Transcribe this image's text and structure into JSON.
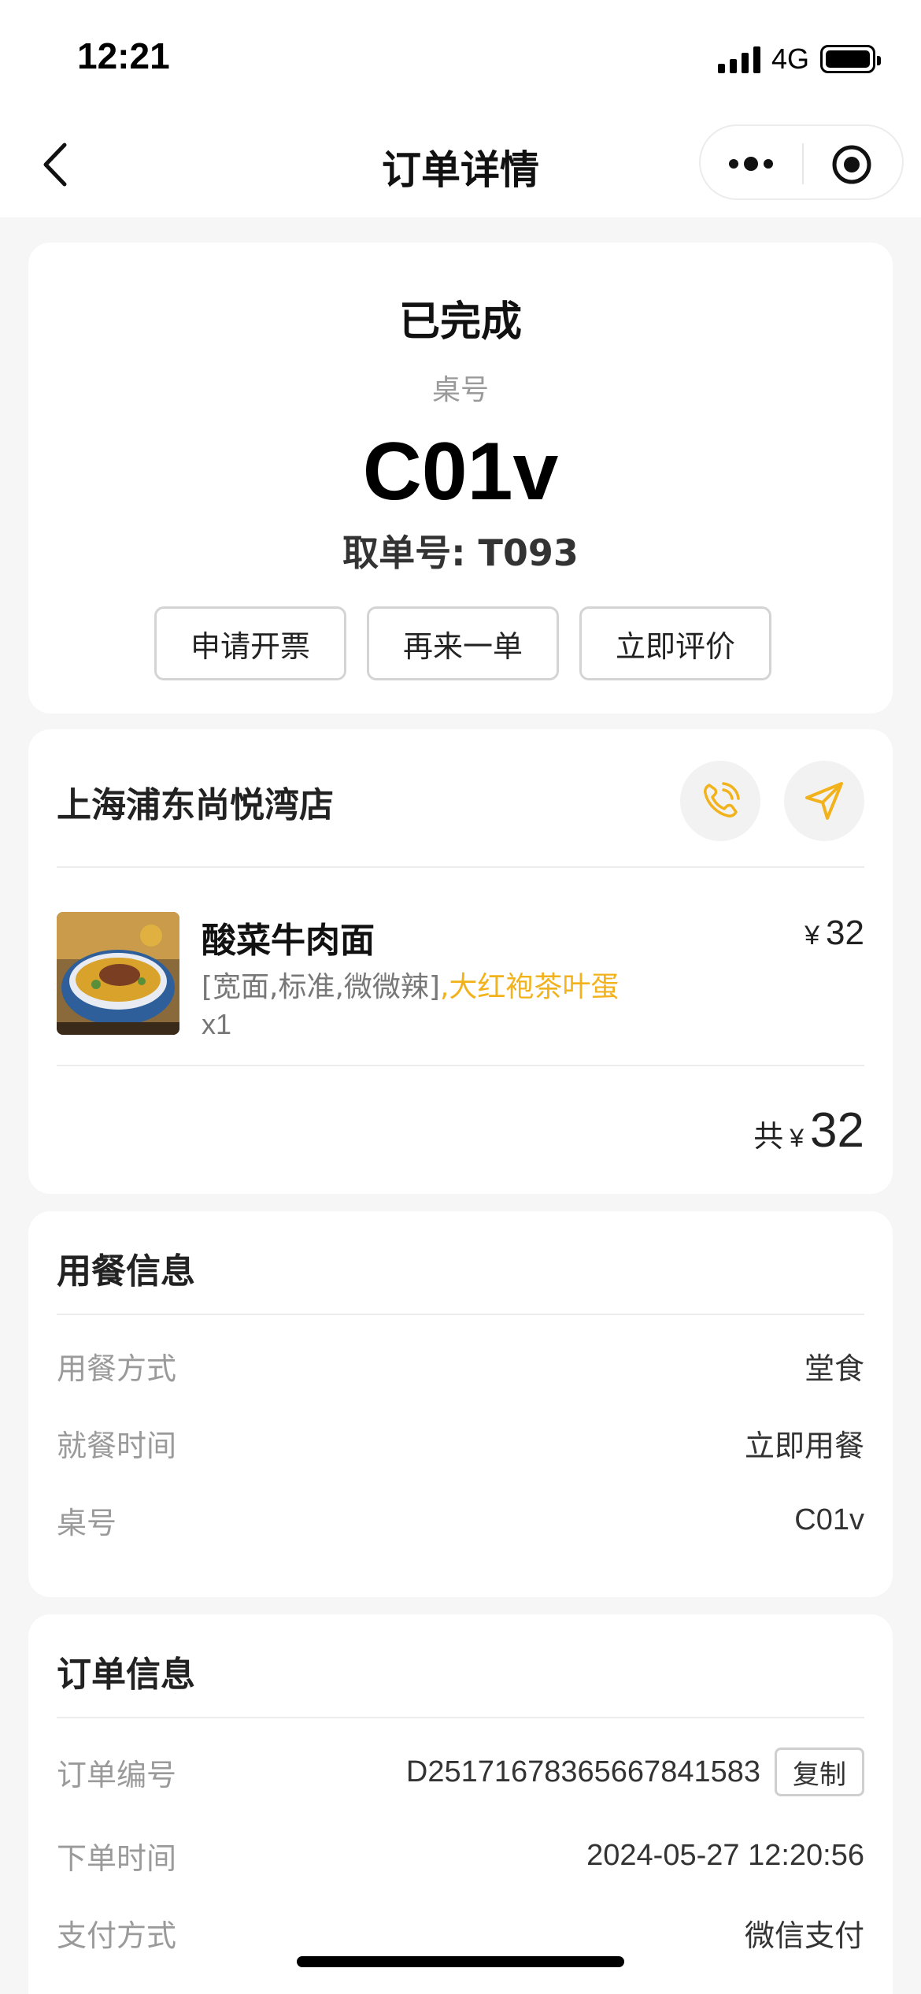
{
  "status_bar": {
    "time": "12:21",
    "network": "4G",
    "battery_level": 1.0
  },
  "nav": {
    "title": "订单详情",
    "icons": [
      "back-arrow-icon",
      "more-icon",
      "target-icon"
    ]
  },
  "order": {
    "status": "已完成",
    "table_label": "桌号",
    "table_no": "C01v",
    "pickup": "取单号: T093",
    "actions": [
      "申请开票",
      "再来一单",
      "立即评价"
    ]
  },
  "store": {
    "name": "上海浦东尚悦湾店",
    "icons": [
      "phone-icon",
      "navigate-icon"
    ],
    "item": {
      "name": "酸菜牛肉面",
      "spec": "[宽面,标准,微微辣]",
      "addon": ",大红袍茶叶蛋",
      "qty": "x1",
      "currency": "¥",
      "price": "32",
      "image_caption": "酸菜牛肉面"
    },
    "total": {
      "label": "共",
      "currency": "¥",
      "amount": "32"
    }
  },
  "dine": {
    "title": "用餐信息",
    "rows": [
      {
        "key": "用餐方式",
        "value": "堂食"
      },
      {
        "key": "就餐时间",
        "value": "立即用餐"
      },
      {
        "key": "桌号",
        "value": "C01v"
      }
    ]
  },
  "info": {
    "title": "订单信息",
    "order_no_key": "订单编号",
    "order_no": "D25171678365667841583",
    "copy_label": "复制",
    "time_key": "下单时间",
    "time": "2024-05-27 12:20:56",
    "pay_key": "支付方式",
    "pay": "微信支付"
  },
  "colors": {
    "accent": "#f2b21c",
    "background": "#f6f6f6",
    "card": "#ffffff"
  }
}
